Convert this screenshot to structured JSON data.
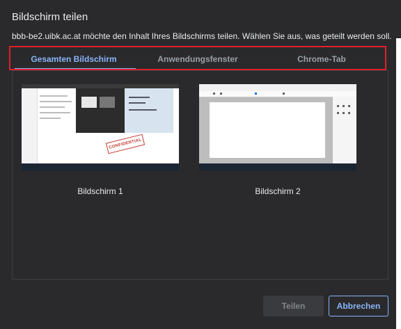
{
  "dialog": {
    "title": "Bildschirm teilen",
    "subtitle": "bbb-be2.uibk.ac.at möchte den Inhalt Ihres Bildschirms teilen. Wählen Sie aus, was geteilt werden soll."
  },
  "tabs": [
    {
      "label": "Gesamten Bildschirm",
      "active": true
    },
    {
      "label": "Anwendungsfenster",
      "active": false
    },
    {
      "label": "Chrome-Tab",
      "active": false
    }
  ],
  "screens": [
    {
      "label": "Bildschirm 1",
      "stamp_text": "CONFIDENTIAL"
    },
    {
      "label": "Bildschirm 2"
    }
  ],
  "buttons": {
    "share_label": "Teilen",
    "cancel_label": "Abbrechen"
  },
  "colors": {
    "accent": "#8ab4f8",
    "highlight_box": "#e0202a",
    "background": "#2a2a2c"
  }
}
